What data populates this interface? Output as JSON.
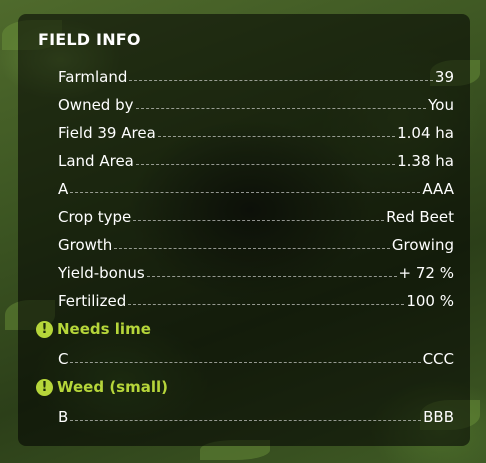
{
  "panel": {
    "title": "FIELD INFO",
    "rows": [
      {
        "label": "Farmland",
        "value": "39"
      },
      {
        "label": "Owned by",
        "value": "You"
      },
      {
        "label": "Field 39 Area",
        "value": "1.04 ha"
      },
      {
        "label": "Land Area",
        "value": "1.38 ha"
      },
      {
        "label": "A",
        "value": "AAA"
      },
      {
        "label": "Crop type",
        "value": "Red Beet"
      },
      {
        "label": "Growth",
        "value": "Growing"
      },
      {
        "label": "Yield-bonus",
        "value": "+ 72 %"
      },
      {
        "label": "Fertilized",
        "value": "100 %"
      }
    ],
    "warning1": {
      "icon": "exclamation-icon",
      "text": "Needs lime"
    },
    "row_c": {
      "label": "C",
      "value": "CCC"
    },
    "warning2": {
      "icon": "exclamation-icon",
      "text": "Weed (small)"
    },
    "row_b": {
      "label": "B",
      "value": "BBB"
    }
  },
  "colors": {
    "warning": "#b6d63a",
    "panel_bg": "rgba(0,0,0,0.55)",
    "text": "#ffffff"
  }
}
